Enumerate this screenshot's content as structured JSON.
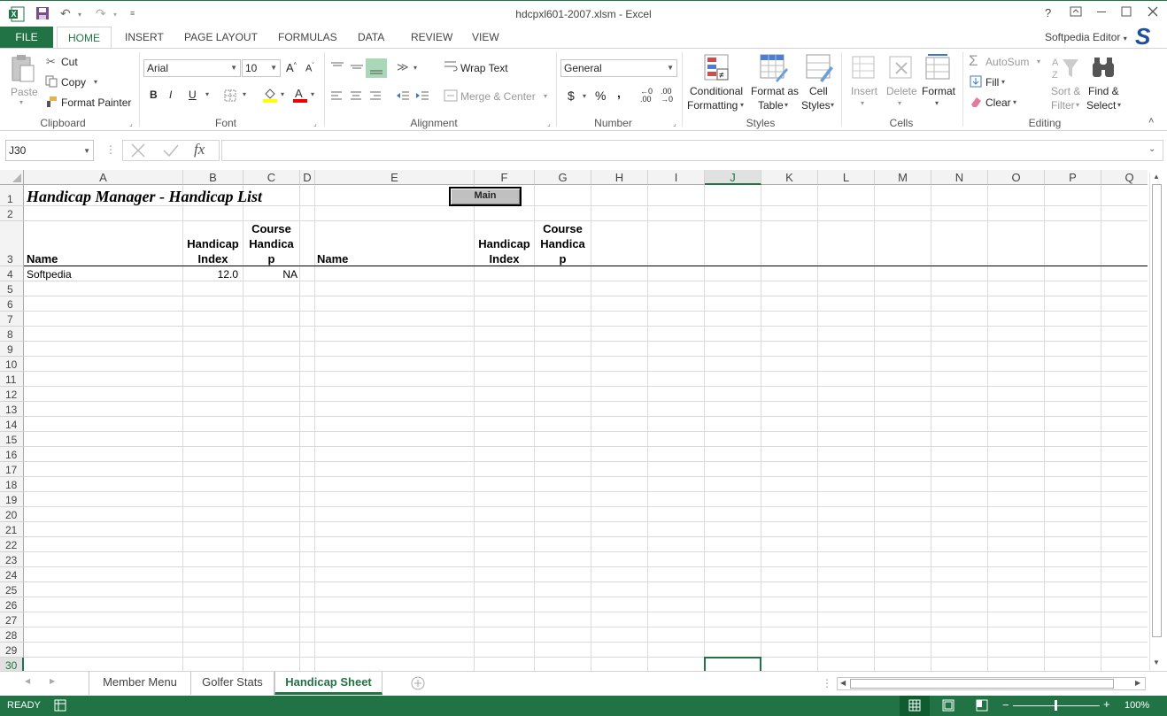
{
  "window": {
    "title": "hdcpxl601-2007.xlsm - Excel",
    "help": "?",
    "user": "Softpedia Editor"
  },
  "ribbon_tabs": [
    "FILE",
    "HOME",
    "INSERT",
    "PAGE LAYOUT",
    "FORMULAS",
    "DATA",
    "REVIEW",
    "VIEW"
  ],
  "ribbon": {
    "clipboard": {
      "paste": "Paste",
      "cut": "Cut",
      "copy": "Copy",
      "format_painter": "Format Painter",
      "label": "Clipboard"
    },
    "font": {
      "name": "Arial",
      "size": "10",
      "bold": "B",
      "italic": "I",
      "underline": "U",
      "label": "Font"
    },
    "alignment": {
      "wrap": "Wrap Text",
      "merge": "Merge & Center",
      "label": "Alignment"
    },
    "number": {
      "format": "General",
      "currency": "$",
      "percent": "%",
      "comma": ",",
      "inc": ".00→.0",
      "label": "Number"
    },
    "styles": {
      "conditional1": "Conditional",
      "conditional2": "Formatting",
      "format_as1": "Format as",
      "format_as2": "Table",
      "cell1": "Cell",
      "cell2": "Styles",
      "label": "Styles"
    },
    "cells": {
      "insert": "Insert",
      "delete": "Delete",
      "format": "Format",
      "label": "Cells"
    },
    "editing": {
      "autosum": "AutoSum",
      "fill": "Fill",
      "clear": "Clear",
      "sort1": "Sort &",
      "sort2": "Filter",
      "find1": "Find &",
      "find2": "Select",
      "label": "Editing"
    }
  },
  "formula_bar": {
    "name_box": "J30",
    "fx": "fx",
    "formula": ""
  },
  "columns": [
    "A",
    "B",
    "C",
    "D",
    "E",
    "F",
    "G",
    "H",
    "I",
    "J",
    "K",
    "L",
    "M",
    "N",
    "O",
    "P",
    "Q"
  ],
  "rows": [
    "1",
    "2",
    "3",
    "4",
    "5",
    "6",
    "7",
    "8",
    "9",
    "10",
    "11",
    "12",
    "13",
    "14",
    "15",
    "16",
    "17",
    "18",
    "19",
    "20",
    "21",
    "22",
    "23",
    "24",
    "25",
    "26",
    "27",
    "28",
    "29",
    "30"
  ],
  "sheet": {
    "title": "Handicap Manager - Handicap List",
    "main_button": "Main",
    "h_name_a": "Name",
    "h_index_b1": "Handicap",
    "h_index_b2": "Index",
    "h_course_c1": "Course",
    "h_course_c2": "Handica",
    "h_course_c3": "p",
    "h_name_e": "Name",
    "h_index_f1": "Handicap",
    "h_index_f2": "Index",
    "h_course_g1": "Course",
    "h_course_g2": "Handica",
    "h_course_g3": "p",
    "r4_name": "Softpedia",
    "r4_index": "12.0",
    "r4_course": "NA"
  },
  "sheet_tabs": [
    "Member Menu",
    "Golfer Stats",
    "Handicap Sheet"
  ],
  "status": {
    "ready": "READY",
    "zoom": "100%"
  },
  "colors": {
    "excel_green": "#217346",
    "grid": "#dadada",
    "header_bg": "#f3f3f3"
  }
}
